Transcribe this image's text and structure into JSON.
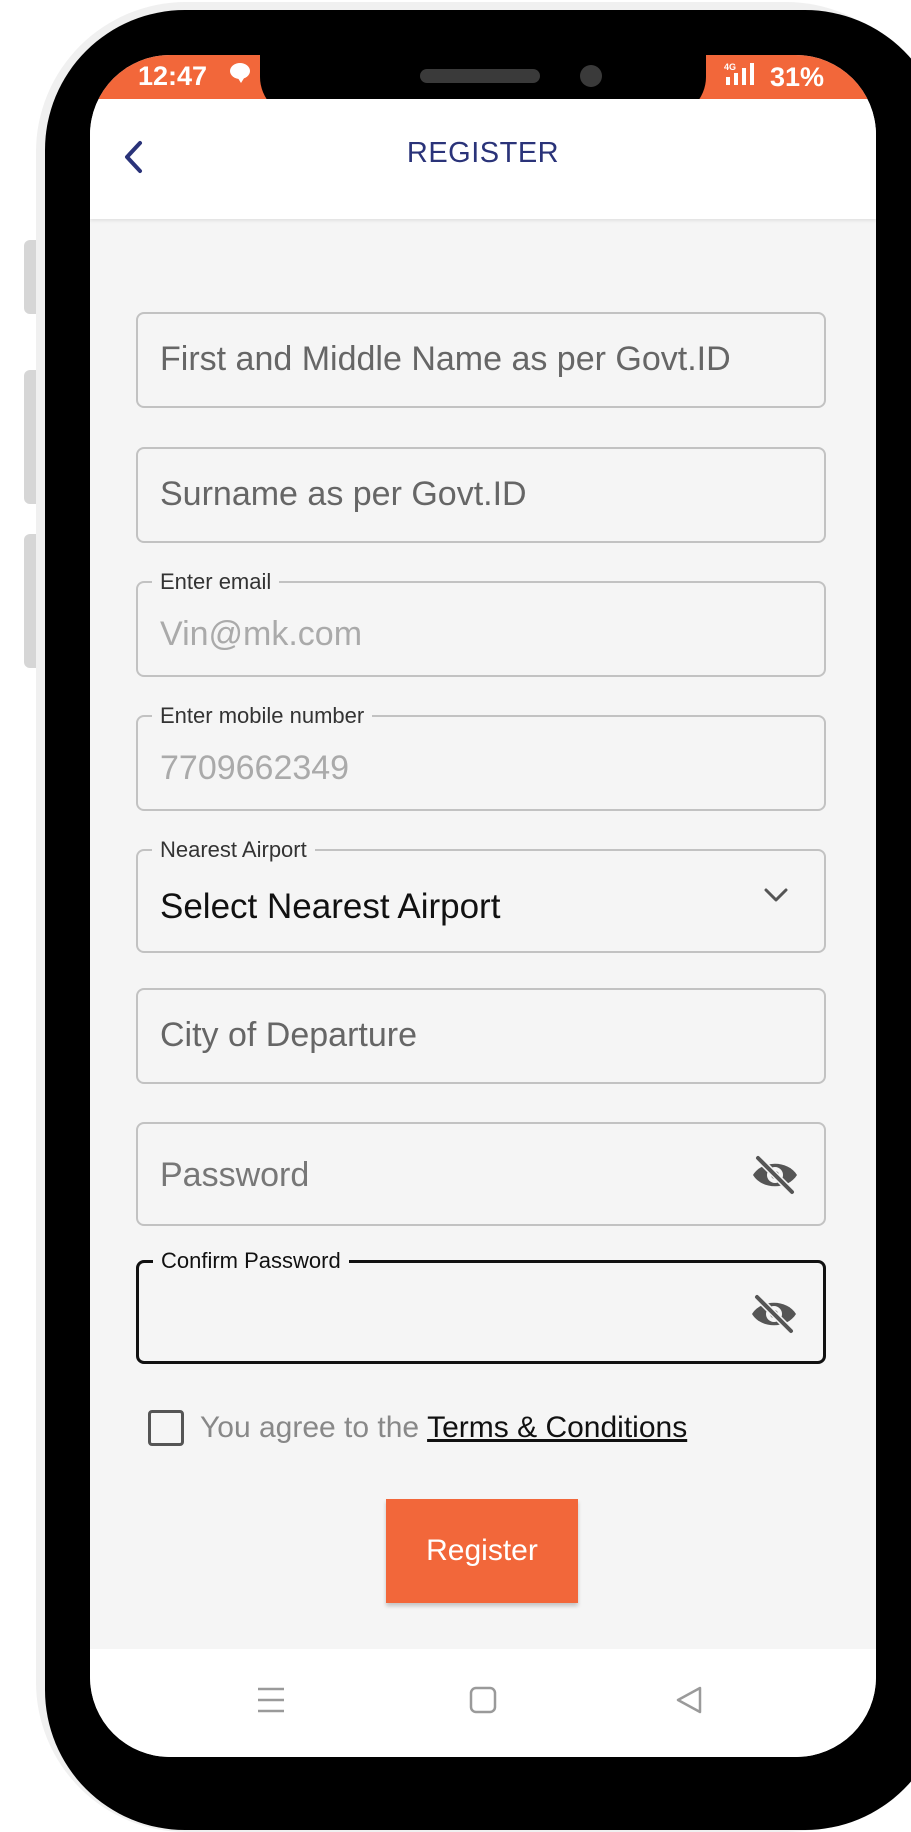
{
  "status_bar": {
    "time": "12:47",
    "signal_label": "4G",
    "battery": "31%",
    "background_color": "#f2673a"
  },
  "header": {
    "title": "REGISTER",
    "back_icon": "chevron-left-icon",
    "title_color": "#2a3379"
  },
  "form": {
    "first_name": {
      "placeholder": "First and Middle Name as per Govt.ID"
    },
    "surname": {
      "placeholder": "Surname as per Govt.ID"
    },
    "email": {
      "label": "Enter email",
      "value": "Vin@mk.com"
    },
    "mobile": {
      "label": "Enter mobile number",
      "value": "7709662349"
    },
    "airport": {
      "label": "Nearest Airport",
      "value": "Select Nearest Airport",
      "icon": "chevron-down-icon"
    },
    "city": {
      "placeholder": "City of Departure"
    },
    "password": {
      "placeholder": "Password",
      "icon": "eye-off-icon"
    },
    "confirm_password": {
      "label": "Confirm Password",
      "value": "",
      "icon": "eye-off-icon"
    },
    "terms": {
      "text": "You agree to the",
      "link": "Terms & Conditions",
      "checked": false
    },
    "register_button": {
      "label": "Register",
      "color": "#f2673a"
    }
  },
  "nav_bar": {
    "icons": [
      "menu-icon",
      "home-square-icon",
      "back-triangle-icon"
    ]
  }
}
